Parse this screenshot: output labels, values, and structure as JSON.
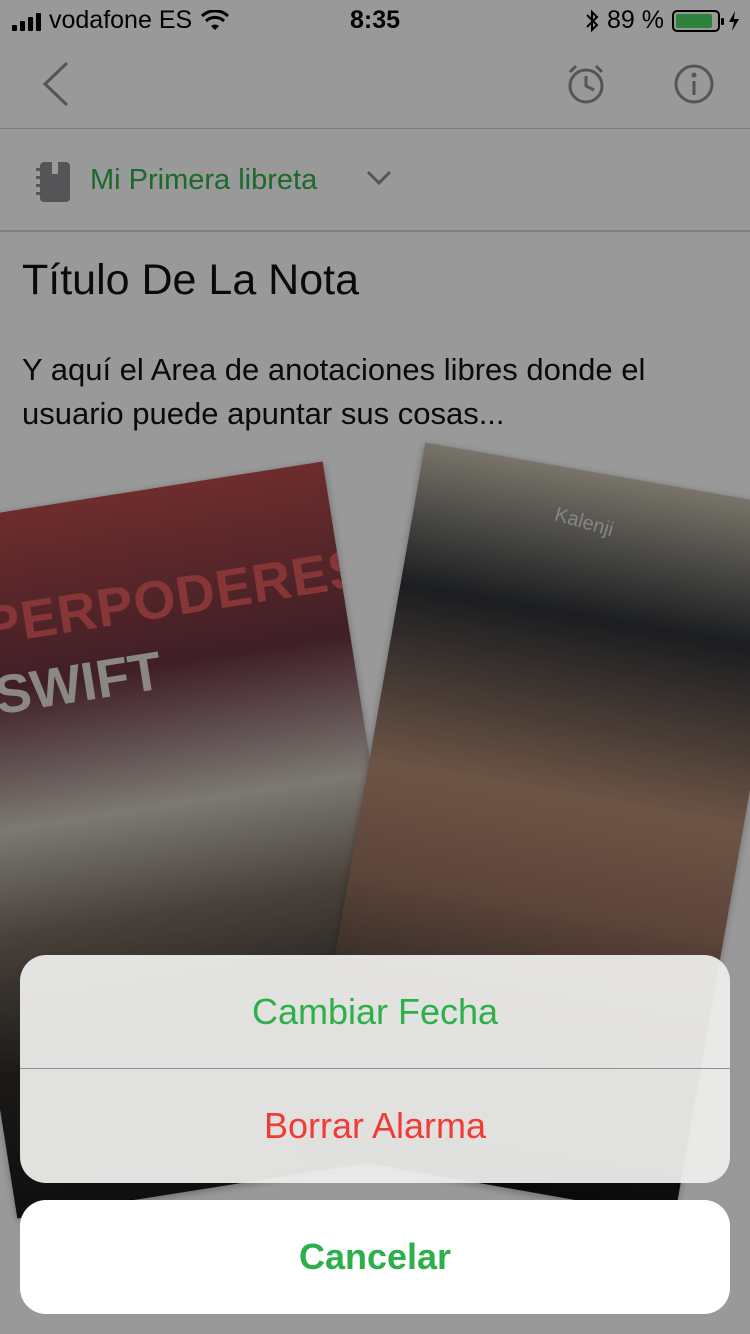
{
  "status_bar": {
    "carrier": "vodafone ES",
    "time": "8:35",
    "battery_percent": "89 %",
    "battery_level": 0.89
  },
  "nav": {
    "back_icon": "chevron-left-icon",
    "alarm_icon": "alarm-clock-icon",
    "info_icon": "info-icon"
  },
  "notebook": {
    "icon": "notebook-icon",
    "name": "Mi Primera libreta",
    "chevron_icon": "chevron-down-icon"
  },
  "note": {
    "title": "Título De La Nota",
    "body": "Y aquí el Area de anotaciones libres donde el usuario puede apuntar sus cosas..."
  },
  "photos": {
    "photo1_text_a": "UPERPODERES",
    "photo1_text_b": "SWIFT",
    "photo2_cap_text": "Kalenji"
  },
  "action_sheet": {
    "change_date": "Cambiar Fecha",
    "delete_alarm": "Borrar Alarma",
    "cancel": "Cancelar"
  },
  "colors": {
    "green": "#2db04a",
    "red": "#f23b36",
    "battery_green": "#4cd964"
  }
}
